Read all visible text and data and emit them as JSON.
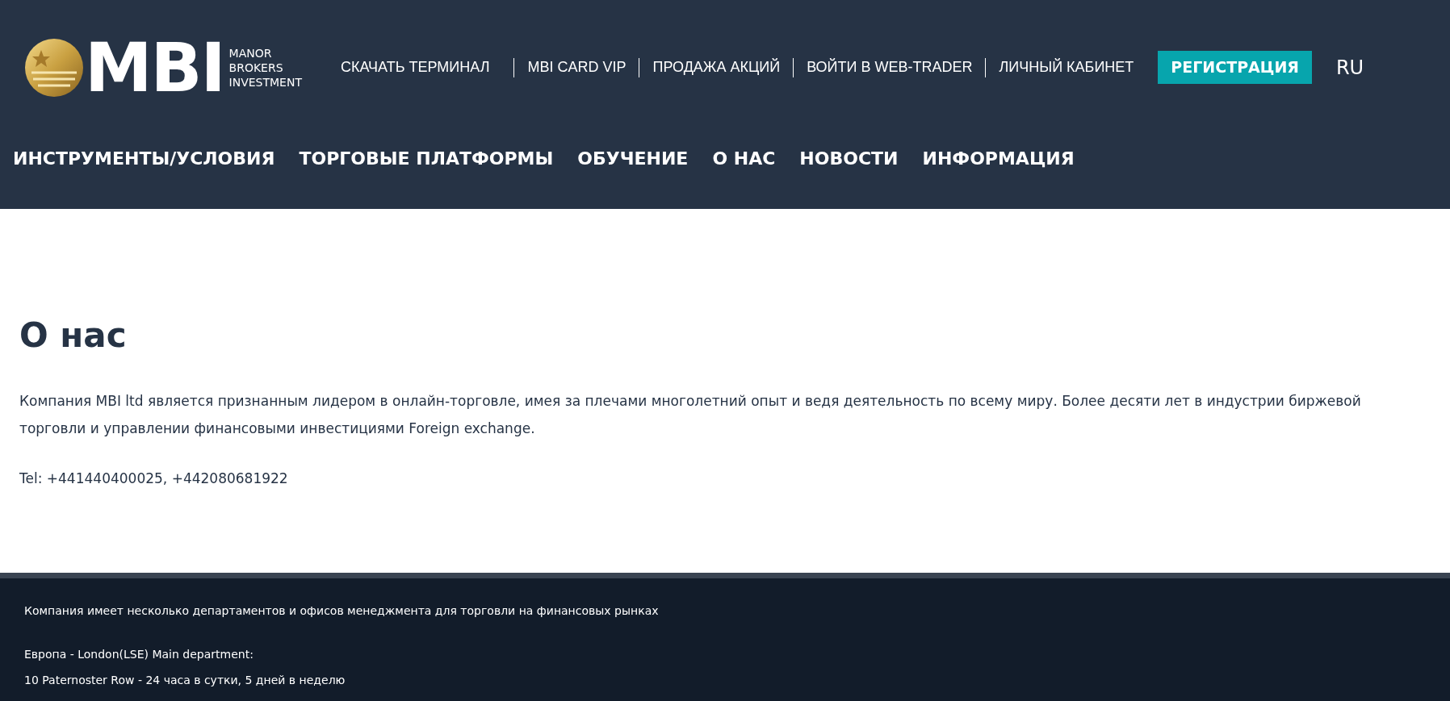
{
  "logo": {
    "mark": "MBI",
    "tagline": [
      "MANOR",
      "BROKERS",
      "INVESTMENT"
    ]
  },
  "top_links": [
    {
      "label": "СКАЧАТЬ ТЕРМИНАЛ",
      "kind": "link"
    },
    {
      "label": "MBI CARD VIP",
      "kind": "link"
    },
    {
      "label": "ПРОДАЖА АКЦИЙ",
      "kind": "link"
    },
    {
      "label": "ВОЙТИ В WEB-TRADER",
      "kind": "link"
    },
    {
      "label": "ЛИЧНЫЙ КАБИНЕТ",
      "kind": "link"
    },
    {
      "label": "РЕГИСТРАЦИЯ",
      "kind": "button"
    },
    {
      "label": "RU",
      "kind": "language"
    }
  ],
  "main_nav": [
    "ИНСТРУМЕНТЫ/УСЛОВИЯ",
    "ТОРГОВЫЕ ПЛАТФОРМЫ",
    "ОБУЧЕНИЕ",
    "О НАС",
    "НОВОСТИ",
    "ИНФОРМАЦИЯ"
  ],
  "content": {
    "title": "О нас",
    "paragraphs": [
      "Компания MBI ltd является признанным лидером в онлайн-торговле, имея за плечами многолетний опыт и ведя деятельность по всему миру. Более десяти лет в индустрии биржевой торговли и управлении финансовыми инвестициями Foreign exchange.",
      "Tel: +441440400025, +442080681922"
    ]
  },
  "footer": {
    "intro": "Компания имеет несколько департаментов и офисов менеджмента для торговли на финансовых рынках",
    "lines": [
      "Европа - London(LSE) Main department:",
      "10 Paternoster Row - 24 часа в сутки, 5 дней в неделю"
    ]
  }
}
